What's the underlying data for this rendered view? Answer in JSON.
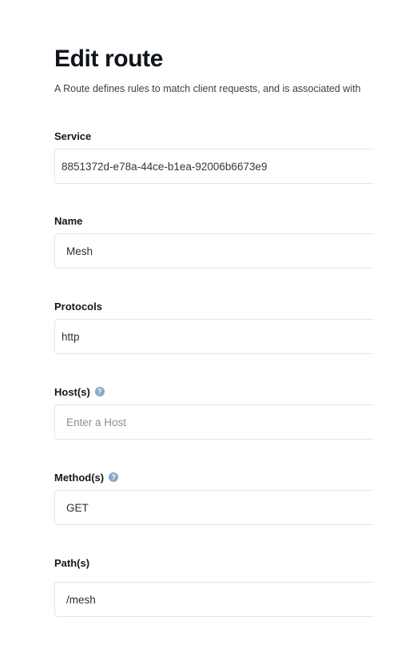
{
  "page": {
    "title": "Edit route",
    "description": "A Route defines rules to match client requests, and is associated with a Service"
  },
  "fields": {
    "service": {
      "label": "Service",
      "value": "8851372d-e78a-44ce-b1ea-92006b6673e9"
    },
    "name": {
      "label": "Name",
      "value": "Mesh"
    },
    "protocols": {
      "label": "Protocols",
      "value": "http"
    },
    "hosts": {
      "label": "Host(s)",
      "placeholder": "Enter a Host",
      "help_icon": "question-circle-icon"
    },
    "methods": {
      "label": "Method(s)",
      "value": "GET",
      "help_icon": "question-circle-icon"
    },
    "paths": {
      "label": "Path(s)",
      "value": "/mesh"
    }
  },
  "colors": {
    "help_icon": "#8aa7cc",
    "input_border": "#e3e5e8",
    "placeholder": "#8a9096"
  }
}
